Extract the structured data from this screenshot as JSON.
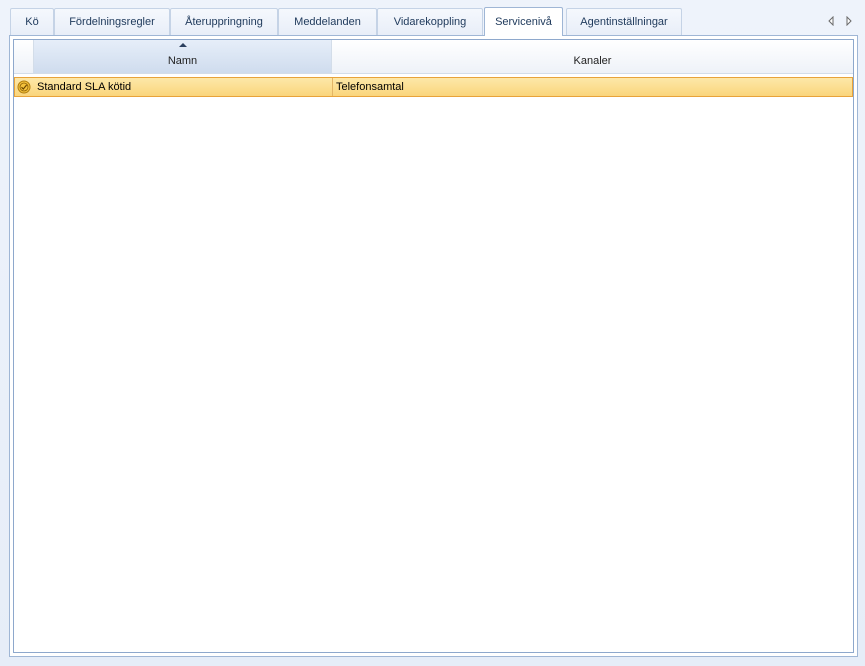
{
  "tabs": [
    {
      "label": "Kö",
      "active": false
    },
    {
      "label": "Fördelningsregler",
      "active": false
    },
    {
      "label": "Återuppringning",
      "active": false
    },
    {
      "label": "Meddelanden",
      "active": false
    },
    {
      "label": "Vidarekoppling",
      "active": false
    },
    {
      "label": "Servicenivå",
      "active": true
    },
    {
      "label": "Agentinställningar",
      "active": false
    }
  ],
  "grid": {
    "columns": [
      {
        "label": "Namn",
        "sorted": "ascending"
      },
      {
        "label": "Kanaler"
      }
    ],
    "rows": [
      {
        "name": "Standard SLA kötid",
        "channels": "Telefonsamtal",
        "selected": true,
        "icon": "sla-clock-icon"
      }
    ]
  },
  "colors": {
    "accent": "#1e395b",
    "selection": "#fad57c",
    "selection_border": "#e8a33a"
  }
}
